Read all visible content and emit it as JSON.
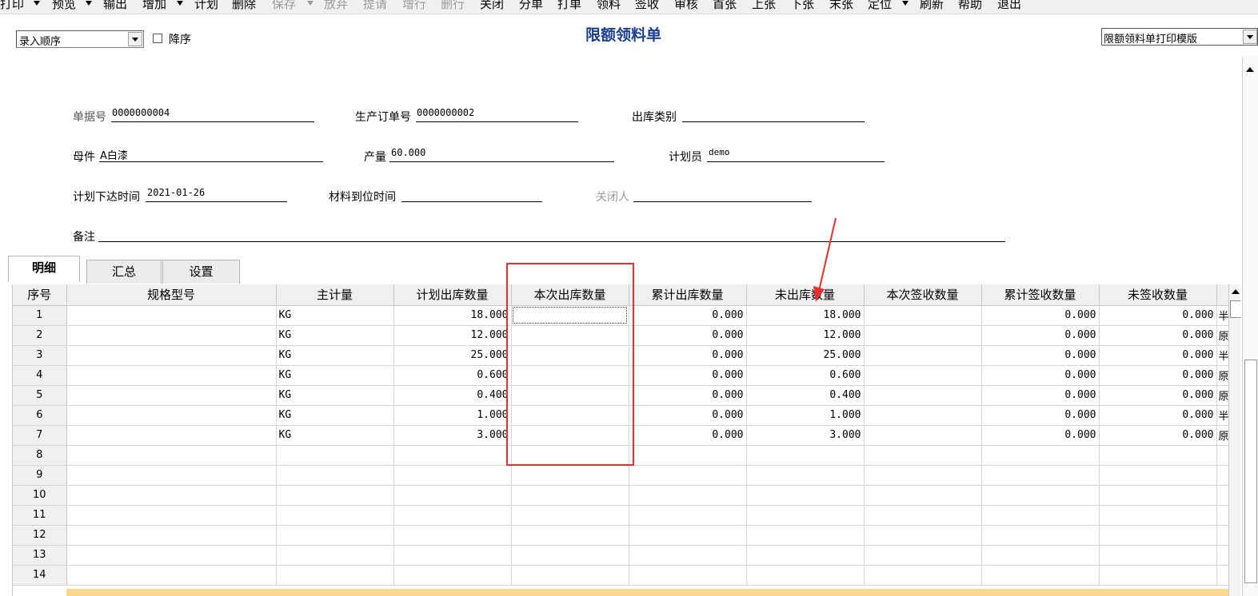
{
  "toolbar": {
    "items": [
      {
        "label": "打印",
        "disabled": false,
        "dropdown": true
      },
      {
        "label": "预览",
        "disabled": false,
        "dropdown": true
      },
      {
        "label": "输出",
        "disabled": false,
        "dropdown": false
      },
      {
        "label": "增加",
        "disabled": false,
        "dropdown": true
      },
      {
        "label": "计划",
        "disabled": false,
        "dropdown": false
      },
      {
        "label": "删除",
        "disabled": false,
        "dropdown": false
      },
      {
        "label": "保存",
        "disabled": true,
        "dropdown": true
      },
      {
        "label": "放弃",
        "disabled": true,
        "dropdown": false
      },
      {
        "label": "提请",
        "disabled": true,
        "dropdown": false
      },
      {
        "label": "增行",
        "disabled": true,
        "dropdown": false
      },
      {
        "label": "删行",
        "disabled": true,
        "dropdown": false
      },
      {
        "label": "关闭",
        "disabled": false,
        "dropdown": false
      },
      {
        "label": "分单",
        "disabled": false,
        "dropdown": false
      },
      {
        "label": "打单",
        "disabled": false,
        "dropdown": false
      },
      {
        "label": "领料",
        "disabled": false,
        "dropdown": false
      },
      {
        "label": "签收",
        "disabled": false,
        "dropdown": false
      },
      {
        "label": "审核",
        "disabled": false,
        "dropdown": false
      },
      {
        "label": "首张",
        "disabled": false,
        "dropdown": false
      },
      {
        "label": "上张",
        "disabled": false,
        "dropdown": false
      },
      {
        "label": "下张",
        "disabled": false,
        "dropdown": false
      },
      {
        "label": "末张",
        "disabled": false,
        "dropdown": false
      },
      {
        "label": "定位",
        "disabled": false,
        "dropdown": true
      },
      {
        "label": "刷新",
        "disabled": false,
        "dropdown": false
      },
      {
        "label": "帮助",
        "disabled": false,
        "dropdown": false
      },
      {
        "label": "退出",
        "disabled": false,
        "dropdown": false
      }
    ]
  },
  "sort": {
    "selected": "录入顺序",
    "descending_label": "降序",
    "descending_checked": false
  },
  "form_title": "限额领料单",
  "print_template": {
    "selected": "限额领料单打印模版"
  },
  "header_fields": {
    "doc_no": {
      "label": "单据号",
      "value": "0000000004"
    },
    "prod_order_no": {
      "label": "生产订单号",
      "value": "0000000002"
    },
    "outbound_type": {
      "label": "出库类别",
      "value": ""
    },
    "parent_item": {
      "label": "母件",
      "value": "A白漆"
    },
    "output_qty": {
      "label": "产量",
      "value": "60.000"
    },
    "planner": {
      "label": "计划员",
      "value": "demo"
    },
    "plan_issue_time": {
      "label": "计划下达时间",
      "value": "2021-01-26"
    },
    "material_arrival_time": {
      "label": "材料到位时间",
      "value": ""
    },
    "closed_by": {
      "label": "关闭人",
      "value": ""
    },
    "remark": {
      "label": "备注",
      "value": ""
    }
  },
  "tabs": [
    {
      "label": "明细",
      "active": true
    },
    {
      "label": "汇总",
      "active": false
    },
    {
      "label": "设置",
      "active": false
    }
  ],
  "grid": {
    "columns": [
      "序号",
      "规格型号",
      "主计量",
      "计划出库数量",
      "本次出库数量",
      "累计出库数量",
      "未出库数量",
      "本次签收数量",
      "累计签收数量",
      "未签收数量"
    ],
    "rows": [
      {
        "no": "1",
        "spec": "",
        "unit": "KG",
        "plan": "18.000",
        "this_out": "",
        "cum_out": "0.000",
        "not_out": "18.000",
        "this_sign": "",
        "cum_sign": "0.000",
        "not_sign": "0.000",
        "extra": "半"
      },
      {
        "no": "2",
        "spec": "",
        "unit": "KG",
        "plan": "12.000",
        "this_out": "",
        "cum_out": "0.000",
        "not_out": "12.000",
        "this_sign": "",
        "cum_sign": "0.000",
        "not_sign": "0.000",
        "extra": "原"
      },
      {
        "no": "3",
        "spec": "",
        "unit": "KG",
        "plan": "25.000",
        "this_out": "",
        "cum_out": "0.000",
        "not_out": "25.000",
        "this_sign": "",
        "cum_sign": "0.000",
        "not_sign": "0.000",
        "extra": "半"
      },
      {
        "no": "4",
        "spec": "",
        "unit": "KG",
        "plan": "0.600",
        "this_out": "",
        "cum_out": "0.000",
        "not_out": "0.600",
        "this_sign": "",
        "cum_sign": "0.000",
        "not_sign": "0.000",
        "extra": "原"
      },
      {
        "no": "5",
        "spec": "",
        "unit": "KG",
        "plan": "0.400",
        "this_out": "",
        "cum_out": "0.000",
        "not_out": "0.400",
        "this_sign": "",
        "cum_sign": "0.000",
        "not_sign": "0.000",
        "extra": "原"
      },
      {
        "no": "6",
        "spec": "",
        "unit": "KG",
        "plan": "1.000",
        "this_out": "",
        "cum_out": "0.000",
        "not_out": "1.000",
        "this_sign": "",
        "cum_sign": "0.000",
        "not_sign": "0.000",
        "extra": "半"
      },
      {
        "no": "7",
        "spec": "",
        "unit": "KG",
        "plan": "3.000",
        "this_out": "",
        "cum_out": "0.000",
        "not_out": "3.000",
        "this_sign": "",
        "cum_sign": "0.000",
        "not_sign": "0.000",
        "extra": "原"
      },
      {
        "no": "8",
        "spec": "",
        "unit": "",
        "plan": "",
        "this_out": "",
        "cum_out": "",
        "not_out": "",
        "this_sign": "",
        "cum_sign": "",
        "not_sign": "",
        "extra": ""
      },
      {
        "no": "9",
        "spec": "",
        "unit": "",
        "plan": "",
        "this_out": "",
        "cum_out": "",
        "not_out": "",
        "this_sign": "",
        "cum_sign": "",
        "not_sign": "",
        "extra": ""
      },
      {
        "no": "10",
        "spec": "",
        "unit": "",
        "plan": "",
        "this_out": "",
        "cum_out": "",
        "not_out": "",
        "this_sign": "",
        "cum_sign": "",
        "not_sign": "",
        "extra": ""
      },
      {
        "no": "11",
        "spec": "",
        "unit": "",
        "plan": "",
        "this_out": "",
        "cum_out": "",
        "not_out": "",
        "this_sign": "",
        "cum_sign": "",
        "not_sign": "",
        "extra": ""
      },
      {
        "no": "12",
        "spec": "",
        "unit": "",
        "plan": "",
        "this_out": "",
        "cum_out": "",
        "not_out": "",
        "this_sign": "",
        "cum_sign": "",
        "not_sign": "",
        "extra": ""
      },
      {
        "no": "13",
        "spec": "",
        "unit": "",
        "plan": "",
        "this_out": "",
        "cum_out": "",
        "not_out": "",
        "this_sign": "",
        "cum_sign": "",
        "not_sign": "",
        "extra": ""
      },
      {
        "no": "14",
        "spec": "",
        "unit": "",
        "plan": "",
        "this_out": "",
        "cum_out": "",
        "not_out": "",
        "this_sign": "",
        "cum_sign": "",
        "not_sign": "",
        "extra": ""
      }
    ]
  },
  "colors": {
    "title": "#1b3f8f",
    "annotation": "#e53030",
    "footer_band": "#fbd98c"
  }
}
